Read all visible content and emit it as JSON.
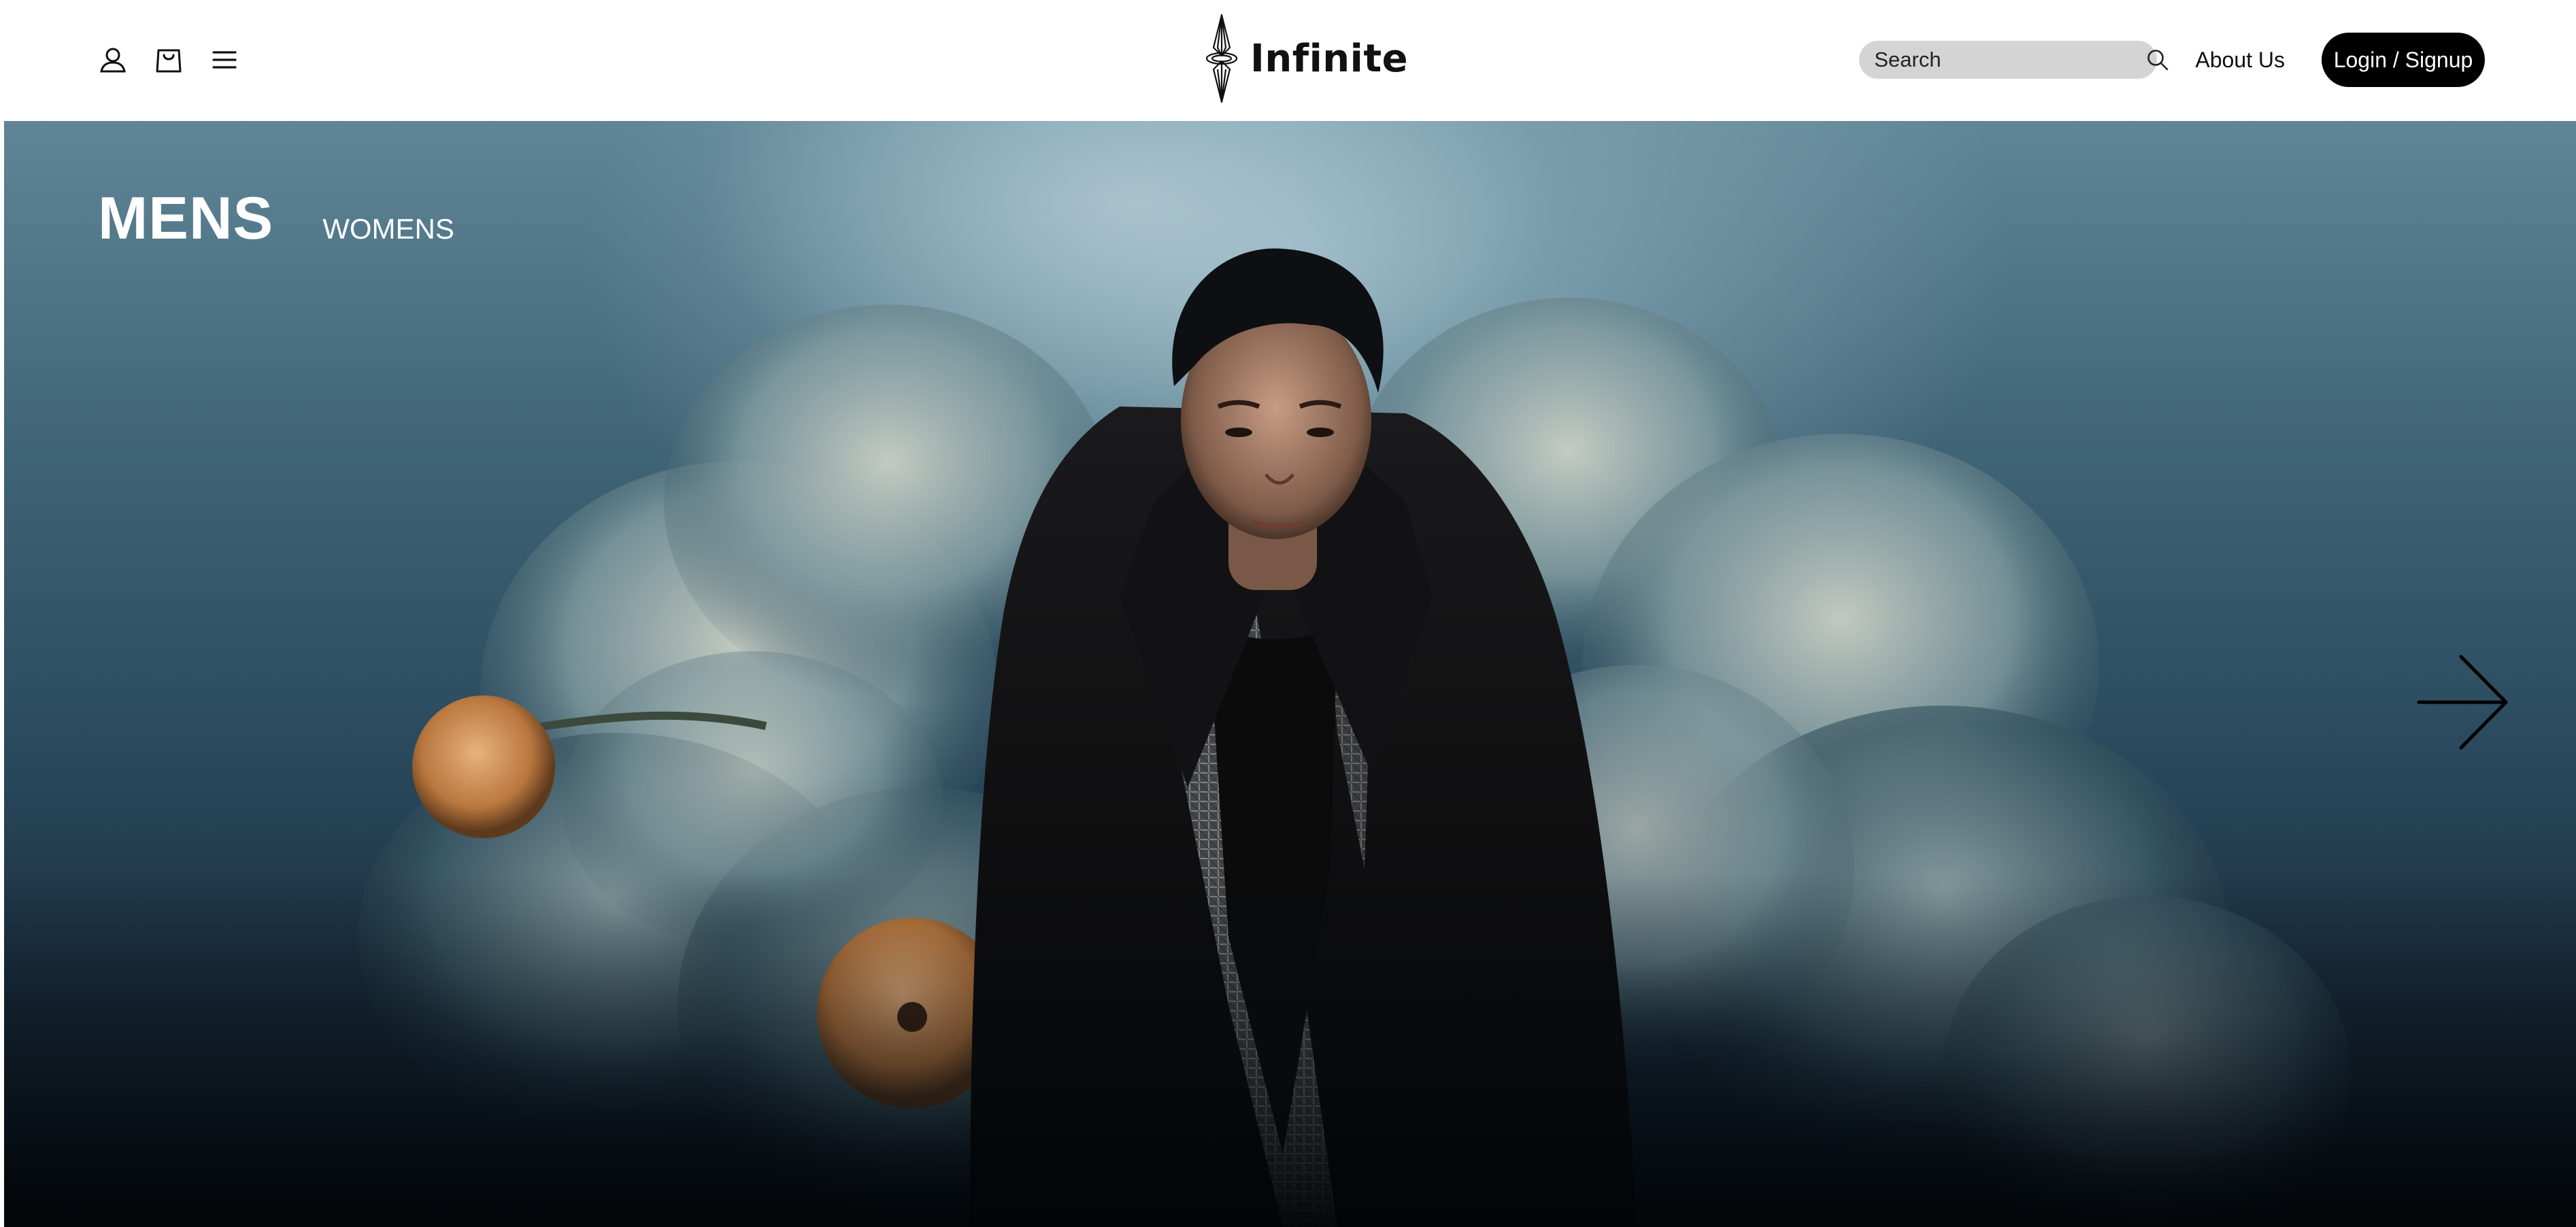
{
  "header": {
    "icons": {
      "account": "user-icon",
      "cart": "shopping-bag-icon",
      "menu": "hamburger-menu-icon"
    },
    "logo_text": "Infinite",
    "search": {
      "placeholder": "Search",
      "value": ""
    },
    "about_label": "About Us",
    "login_label": "Login / Signup"
  },
  "hero": {
    "tabs": [
      {
        "label": "MENS",
        "active": true
      },
      {
        "label": "WOMENS",
        "active": false
      }
    ],
    "next_icon": "arrow-right-icon",
    "image_alt_subject": "fashion-model-photo"
  },
  "colors": {
    "accent": "#000000",
    "search_bg": "#d4d4d4",
    "header_bg": "#ffffff",
    "hero_sky": "#5f8597",
    "hero_dark": "#0a141d"
  }
}
